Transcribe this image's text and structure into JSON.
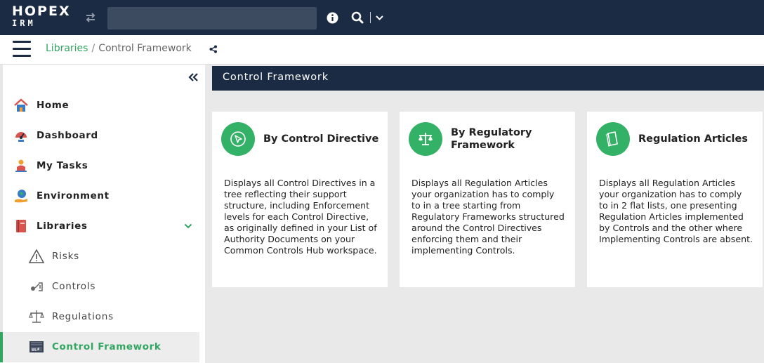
{
  "app": {
    "logo_main": "HOPEX",
    "logo_sub": "IRM"
  },
  "topbar": {
    "search_value": "",
    "icons": [
      "swap-arrows-icon",
      "info-icon",
      "search-icon",
      "chevron-down-icon"
    ]
  },
  "breadcrumb": {
    "items": [
      {
        "label": "Libraries"
      },
      {
        "label": "Control Framework"
      }
    ],
    "separator": "/"
  },
  "sidebar": {
    "items": [
      {
        "label": "Home",
        "icon": "home-icon"
      },
      {
        "label": "Dashboard",
        "icon": "dashboard-icon"
      },
      {
        "label": "My Tasks",
        "icon": "tasks-icon"
      },
      {
        "label": "Environment",
        "icon": "environment-icon"
      },
      {
        "label": "Libraries",
        "icon": "book-icon",
        "expanded": true
      },
      {
        "label": "Risks",
        "icon": "warning-triangle-icon"
      },
      {
        "label": "Controls",
        "icon": "controls-icon"
      },
      {
        "label": "Regulations",
        "icon": "scales-icon"
      },
      {
        "label": "Control Framework",
        "icon": "ucf-icon",
        "active": true
      }
    ]
  },
  "main": {
    "title": "Control Framework",
    "cards": [
      {
        "title": "By Control Directive",
        "icon": "cursor-icon",
        "description": "Displays all Control Directives in a tree reflecting their support structure, including Enforcement levels for each Control Directive, as originally defined in your List of Authority Documents on your Common Controls Hub workspace."
      },
      {
        "title": "By Regulatory Framework",
        "icon": "scales-icon",
        "description": "Displays all Regulation Articles your organization has to comply to in a tree starting from Regulatory Frameworks structured around the Control Directives enforcing them and their implementing Controls."
      },
      {
        "title": "Regulation Articles",
        "icon": "article-icon",
        "description": "Displays all Regulation Articles your organization has to comply to in 2 flat lists, one presenting Regulation Articles implemented by Controls and the other where Implementing Controls are absent."
      }
    ]
  },
  "colors": {
    "navy": "#1c2b44",
    "accent_green": "#31a660",
    "card_circle": "#33b166"
  }
}
